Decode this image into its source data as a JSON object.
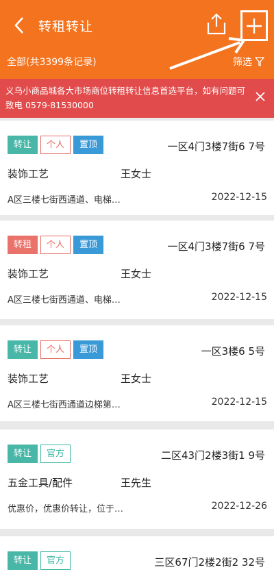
{
  "header": {
    "title": "转租转让",
    "record_count": "全部(共3399条记录)",
    "filter_label": "筛选"
  },
  "notice": {
    "text": "义乌小商品城各大市场商位转租转让信息首选平台，如有问题可致电 0579-81530000"
  },
  "listings": [
    {
      "type": "转让",
      "type_style": "zhuanrang",
      "source": "个人",
      "source_style": "geren",
      "pinned": "置顶",
      "location": "一区4门3楼7街6 7号",
      "category": "装饰工艺",
      "contact": "王女士",
      "description": "A区三楼七街西通道、电梯…",
      "date": "2022-12-15"
    },
    {
      "type": "转租",
      "type_style": "zhuanzu",
      "source": "个人",
      "source_style": "geren",
      "pinned": "置顶",
      "location": "一区4门3楼7街6 7号",
      "category": "装饰工艺",
      "contact": "王女士",
      "description": "A区三楼七街西通道、电梯…",
      "date": "2022-12-15"
    },
    {
      "type": "转让",
      "type_style": "zhuanrang",
      "source": "个人",
      "source_style": "geren",
      "pinned": "置顶",
      "location": "一区3楼6 5号",
      "category": "装饰工艺",
      "contact": "王女士",
      "description": "A区三楼七街西通道边梯第…",
      "date": "2022-12-15"
    },
    {
      "type": "转让",
      "type_style": "zhuanrang",
      "source": "官方",
      "source_style": "guanfang",
      "pinned": "",
      "location": "二区43门2楼3街1 9号",
      "category": "五金工具/配件",
      "contact": "王先生",
      "description": "优惠价，优惠价转让，位于…",
      "date": "2022-12-26"
    },
    {
      "type": "转让",
      "type_style": "zhuanrang",
      "source": "官方",
      "source_style": "guanfang",
      "pinned": "",
      "location": "三区67门2楼2街2 32号",
      "category": "",
      "contact": "",
      "description": "",
      "date": ""
    }
  ],
  "colors": {
    "header_bg": "#f4731f",
    "notice_bg": "#e24b4b",
    "tag_transfer": "#48b7a7",
    "tag_sublet": "#e9736b",
    "tag_pinned": "#3a9ad8"
  }
}
